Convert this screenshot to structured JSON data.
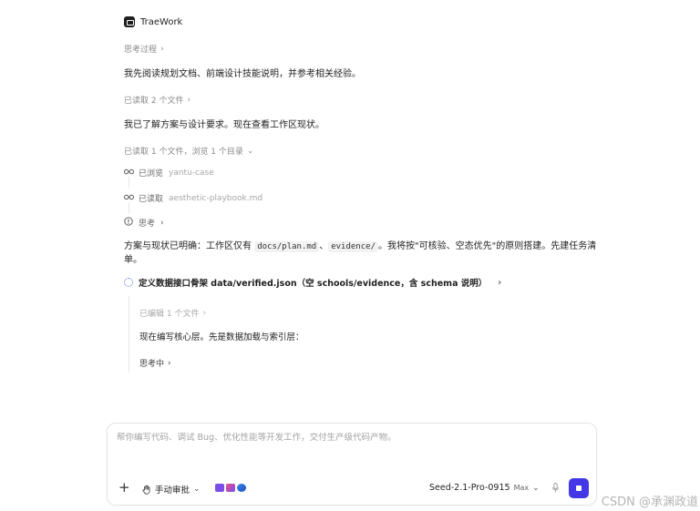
{
  "app": {
    "name": "TraeWork"
  },
  "thinking_process": {
    "label": "思考过程",
    "chevron": "›"
  },
  "messages": {
    "m1": "我先阅读规划文档、前端设计技能说明，并参考相关经验。",
    "read_files": "已读取 2 个文件",
    "m2": "我已了解方案与设计要求。现在查看工作区现状。",
    "read_and_browse": "已读取 1 个文件，浏览 1 个目录",
    "m3_part1": "方案与现状已明确：工作区仅有 ",
    "m3_code1": "docs/plan.md",
    "m3_sep": "、",
    "m3_code2": "evidence/",
    "m3_part2": "。我将按\"可核验、空态优先\"的原则搭建。先建任务清",
    "m3_line2": "单。"
  },
  "steps": [
    {
      "icon": "glasses-icon",
      "label": "已浏览",
      "target": "yantu-case"
    },
    {
      "icon": "glasses-icon",
      "label": "已读取",
      "target": "aesthetic-playbook.md"
    },
    {
      "icon": "info-icon",
      "label": "思考",
      "target": ""
    }
  ],
  "task": {
    "title": "定义数据接口骨架 data/verified.json（空 schools/evidence，含 schema 说明）",
    "edited": "已编辑 1 个文件",
    "note": "现在编写核心层。先是数据加载与索引层：",
    "thinking": "思考中"
  },
  "composer": {
    "placeholder": "帮你编写代码、调试 Bug、优化性能等开发工作，交付生产级代码产物。",
    "plus": "+",
    "approval_label": "手动审批",
    "model": "Seed-2.1-Pro-0915",
    "model_badge": "Max"
  },
  "watermark": "CSDN @承渊政道",
  "colors": {
    "accent": "#4438e6",
    "muted": "#8a8a8a"
  }
}
